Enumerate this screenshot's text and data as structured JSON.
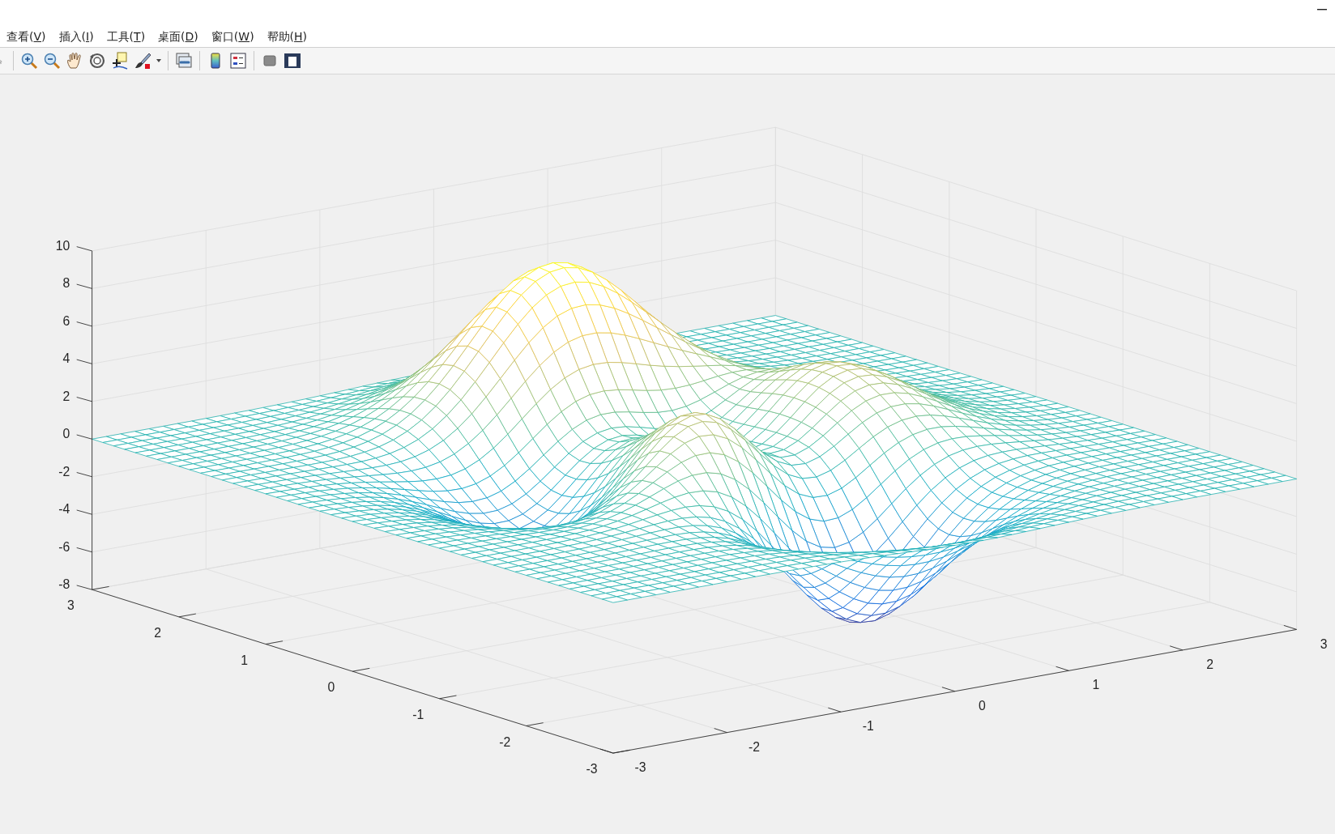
{
  "menu": [
    {
      "label": "查看(V)"
    },
    {
      "label": "插入(I)"
    },
    {
      "label": "工具(T)"
    },
    {
      "label": "桌面(D)"
    },
    {
      "label": "窗口(W)"
    },
    {
      "label": "帮助(H)"
    }
  ],
  "plot": {
    "z_ticks": [
      "10",
      "8",
      "6",
      "4",
      "2",
      "0",
      "-2",
      "-4",
      "-6",
      "-8"
    ],
    "y_ticks": [
      "3",
      "2",
      "1",
      "0",
      "-1",
      "-2",
      "-3"
    ],
    "x_ticks": [
      "-3",
      "-2",
      "-1",
      "0",
      "1",
      "2",
      "3"
    ]
  }
}
